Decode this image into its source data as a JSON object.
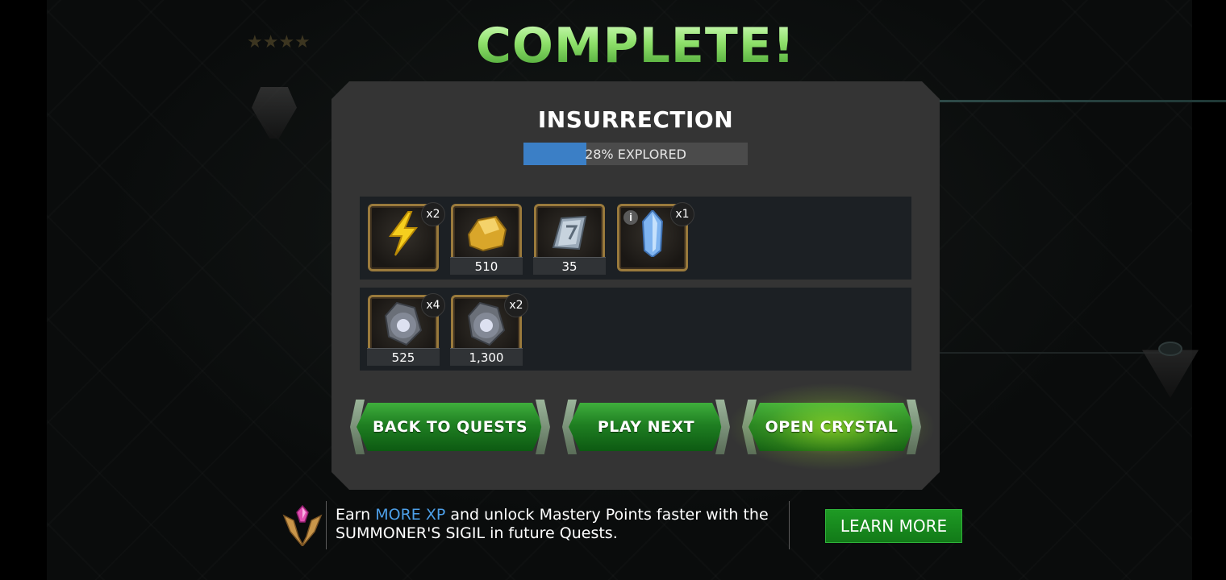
{
  "header": {
    "title": "COMPLETE!"
  },
  "quest": {
    "name": "INSURRECTION",
    "progress_text": "28% EXPLORED",
    "progress_fraction": 0.28
  },
  "rewards": {
    "row1": [
      {
        "icon": "energy-bolt-icon",
        "badge": "x2",
        "label": ""
      },
      {
        "icon": "gold-icon",
        "badge": "",
        "label": "510"
      },
      {
        "icon": "iso8-icon",
        "badge": "",
        "label": "35"
      },
      {
        "icon": "crystal-icon",
        "badge": "x1",
        "label": "",
        "info": "i"
      }
    ],
    "row2": [
      {
        "icon": "catalyst-shard-icon",
        "badge": "x4",
        "label": "525"
      },
      {
        "icon": "catalyst-shard-icon",
        "badge": "x2",
        "label": "1,300"
      }
    ]
  },
  "buttons": {
    "back": "BACK TO QUESTS",
    "play_next": "PLAY NEXT",
    "open_crystal": "OPEN CRYSTAL"
  },
  "promo": {
    "text_pre": "Earn ",
    "highlight": "MORE XP",
    "text_mid": " and unlock Mastery Points faster with the",
    "text_line2": "SUMMONER'S SIGIL in future Quests.",
    "learn_more": "LEARN MORE"
  },
  "colors": {
    "title_green": "#8ee06a",
    "progress_blue": "#3b7fc6",
    "button_green": "#1f7f22",
    "highlight_blue": "#4d9fe8",
    "panel": "#343434"
  }
}
